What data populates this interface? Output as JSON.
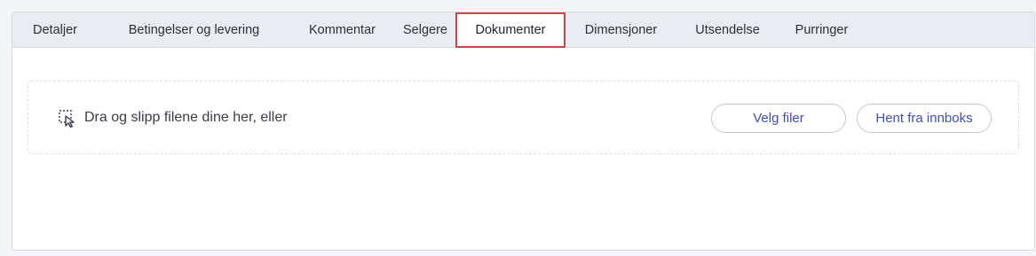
{
  "tabs": [
    {
      "label": "Detaljer",
      "active": false
    },
    {
      "label": "Betingelser og levering",
      "active": false
    },
    {
      "label": "Kommentar",
      "active": false
    },
    {
      "label": "Selgere",
      "active": false
    },
    {
      "label": "Dokumenter",
      "active": true
    },
    {
      "label": "Dimensjoner",
      "active": false
    },
    {
      "label": "Utsendelse",
      "active": false
    },
    {
      "label": "Purringer",
      "active": false
    }
  ],
  "dropzone": {
    "icon": "drag-drop-select-icon",
    "text": "Dra og slipp filene dine her, eller",
    "choose_files_label": "Velg filer",
    "fetch_inbox_label": "Hent fra innboks"
  },
  "colors": {
    "active_tab_border": "#d0434a",
    "button_text": "#3f4fb3",
    "tabbar_bg": "#e9ecf3"
  }
}
